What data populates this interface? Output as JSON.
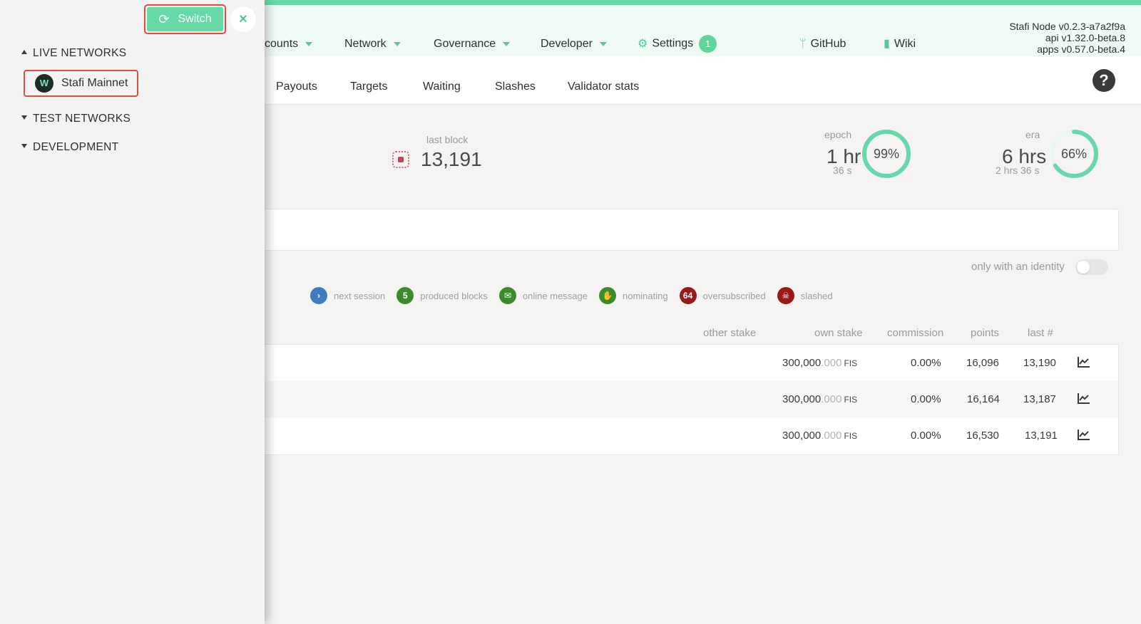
{
  "header": {
    "nav": [
      {
        "label": "counts"
      },
      {
        "label": "Network"
      },
      {
        "label": "Governance"
      },
      {
        "label": "Developer"
      }
    ],
    "settings_label": "Settings",
    "settings_badge": "1",
    "github_label": "GitHub",
    "wiki_label": "Wiki",
    "version_lines": [
      "Stafi Node v0.2.3-a7a2f9a",
      "api v1.32.0-beta.8",
      "apps v0.57.0-beta.4"
    ]
  },
  "subtabs": [
    "Payouts",
    "Targets",
    "Waiting",
    "Slashes",
    "Validator stats"
  ],
  "summary": {
    "last_block_label": "last block",
    "last_block_value": "13,191",
    "epoch_label": "epoch",
    "epoch_value": "1 hr",
    "epoch_remaining": "36 s",
    "epoch_percent": 99,
    "epoch_percent_text": "99%",
    "era_label": "era",
    "era_value": "6 hrs",
    "era_remaining": "2 hrs 36 s",
    "era_percent": 66,
    "era_percent_text": "66%"
  },
  "filter": {
    "identity_label": "only with an identity",
    "identity_on": false
  },
  "legend": [
    {
      "icon": "chevron-right-icon",
      "symbol": "›",
      "color": "#3f7bbf",
      "label": "next session"
    },
    {
      "icon": "produced-blocks-badge",
      "symbol": "5",
      "color": "#3b8b2a",
      "label": "produced blocks"
    },
    {
      "icon": "envelope-icon",
      "symbol": "✉",
      "color": "#3b8b2a",
      "label": "online message"
    },
    {
      "icon": "hand-icon",
      "symbol": "✋",
      "color": "#3b8b2a",
      "label": "nominating"
    },
    {
      "icon": "oversubscribed-badge",
      "symbol": "64",
      "color": "#9a1a1a",
      "label": "oversubscribed"
    },
    {
      "icon": "skull-icon",
      "symbol": "☠",
      "color": "#9a1a1a",
      "label": "slashed"
    }
  ],
  "table": {
    "headers": {
      "other_stake": "other stake",
      "own_stake": "own stake",
      "commission": "commission",
      "points": "points",
      "last": "last #"
    },
    "rows": [
      {
        "own_int": "300,000",
        "own_dec": ".000",
        "unit": "FIS",
        "commission": "0.00%",
        "points": "16,096",
        "last": "13,190"
      },
      {
        "own_int": "300,000",
        "own_dec": ".000",
        "unit": "FIS",
        "commission": "0.00%",
        "points": "16,164",
        "last": "13,187"
      },
      {
        "own_int": "300,000",
        "own_dec": ".000",
        "unit": "FIS",
        "commission": "0.00%",
        "points": "16,530",
        "last": "13,191"
      }
    ]
  },
  "sidebar": {
    "switch_label": "Switch",
    "close_symbol": "×",
    "live_networks": "LIVE NETWORKS",
    "network_item": "Stafi Mainnet",
    "test_networks": "TEST NETWORKS",
    "development": "DEVELOPMENT"
  },
  "colors": {
    "accent": "#67d9a8",
    "highlight_border": "#e64a3c"
  }
}
